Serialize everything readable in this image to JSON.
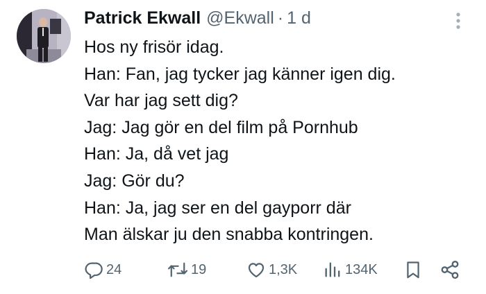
{
  "author": {
    "name": "Patrick Ekwall",
    "handle": "@Ekwall",
    "separator": "·",
    "time": "1 d"
  },
  "tweet": {
    "lines": [
      "Hos ny frisör idag.",
      "Han: Fan, jag tycker jag känner igen dig.",
      "Var har jag sett dig?",
      "Jag: Jag gör en del film på Pornhub",
      "Han: Ja, då vet jag",
      "Jag: Gör du?",
      "Han: Ja, jag ser en del gayporr där",
      "Man älskar ju den snabba kontringen."
    ]
  },
  "actions": {
    "replies": "24",
    "retweets": "19",
    "likes": "1,3K",
    "views": "134K"
  },
  "icons": {
    "more": "more-vertical-icon",
    "reply": "reply-icon",
    "retweet": "retweet-icon",
    "like": "heart-icon",
    "views": "views-chart-icon",
    "bookmark": "bookmark-icon",
    "share": "share-icon"
  },
  "colors": {
    "text": "#0f1419",
    "secondary": "#536471"
  }
}
